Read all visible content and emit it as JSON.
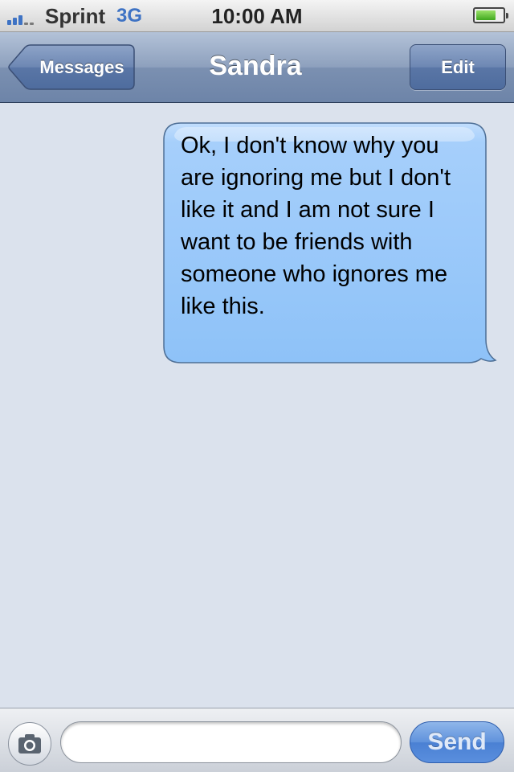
{
  "status_bar": {
    "carrier": "Sprint",
    "network": "3G",
    "time": "10:00 AM",
    "signal_bars": 3,
    "signal_total": 5,
    "battery_level": 0.75,
    "signal_color": "#3f73c4",
    "battery_color": "#4cb12a"
  },
  "nav": {
    "back_label": "Messages",
    "title": "Sandra",
    "edit_label": "Edit"
  },
  "conversation": {
    "messages": [
      {
        "direction": "outgoing",
        "text": "Ok, I don't know why you are ignoring me but I don't like it and I am not sure I want to be friends with someone who ignores me like this."
      }
    ],
    "bubble_color": "#9fcbfb"
  },
  "composer": {
    "camera_icon": "camera-icon",
    "input_value": "",
    "send_label": "Send"
  }
}
